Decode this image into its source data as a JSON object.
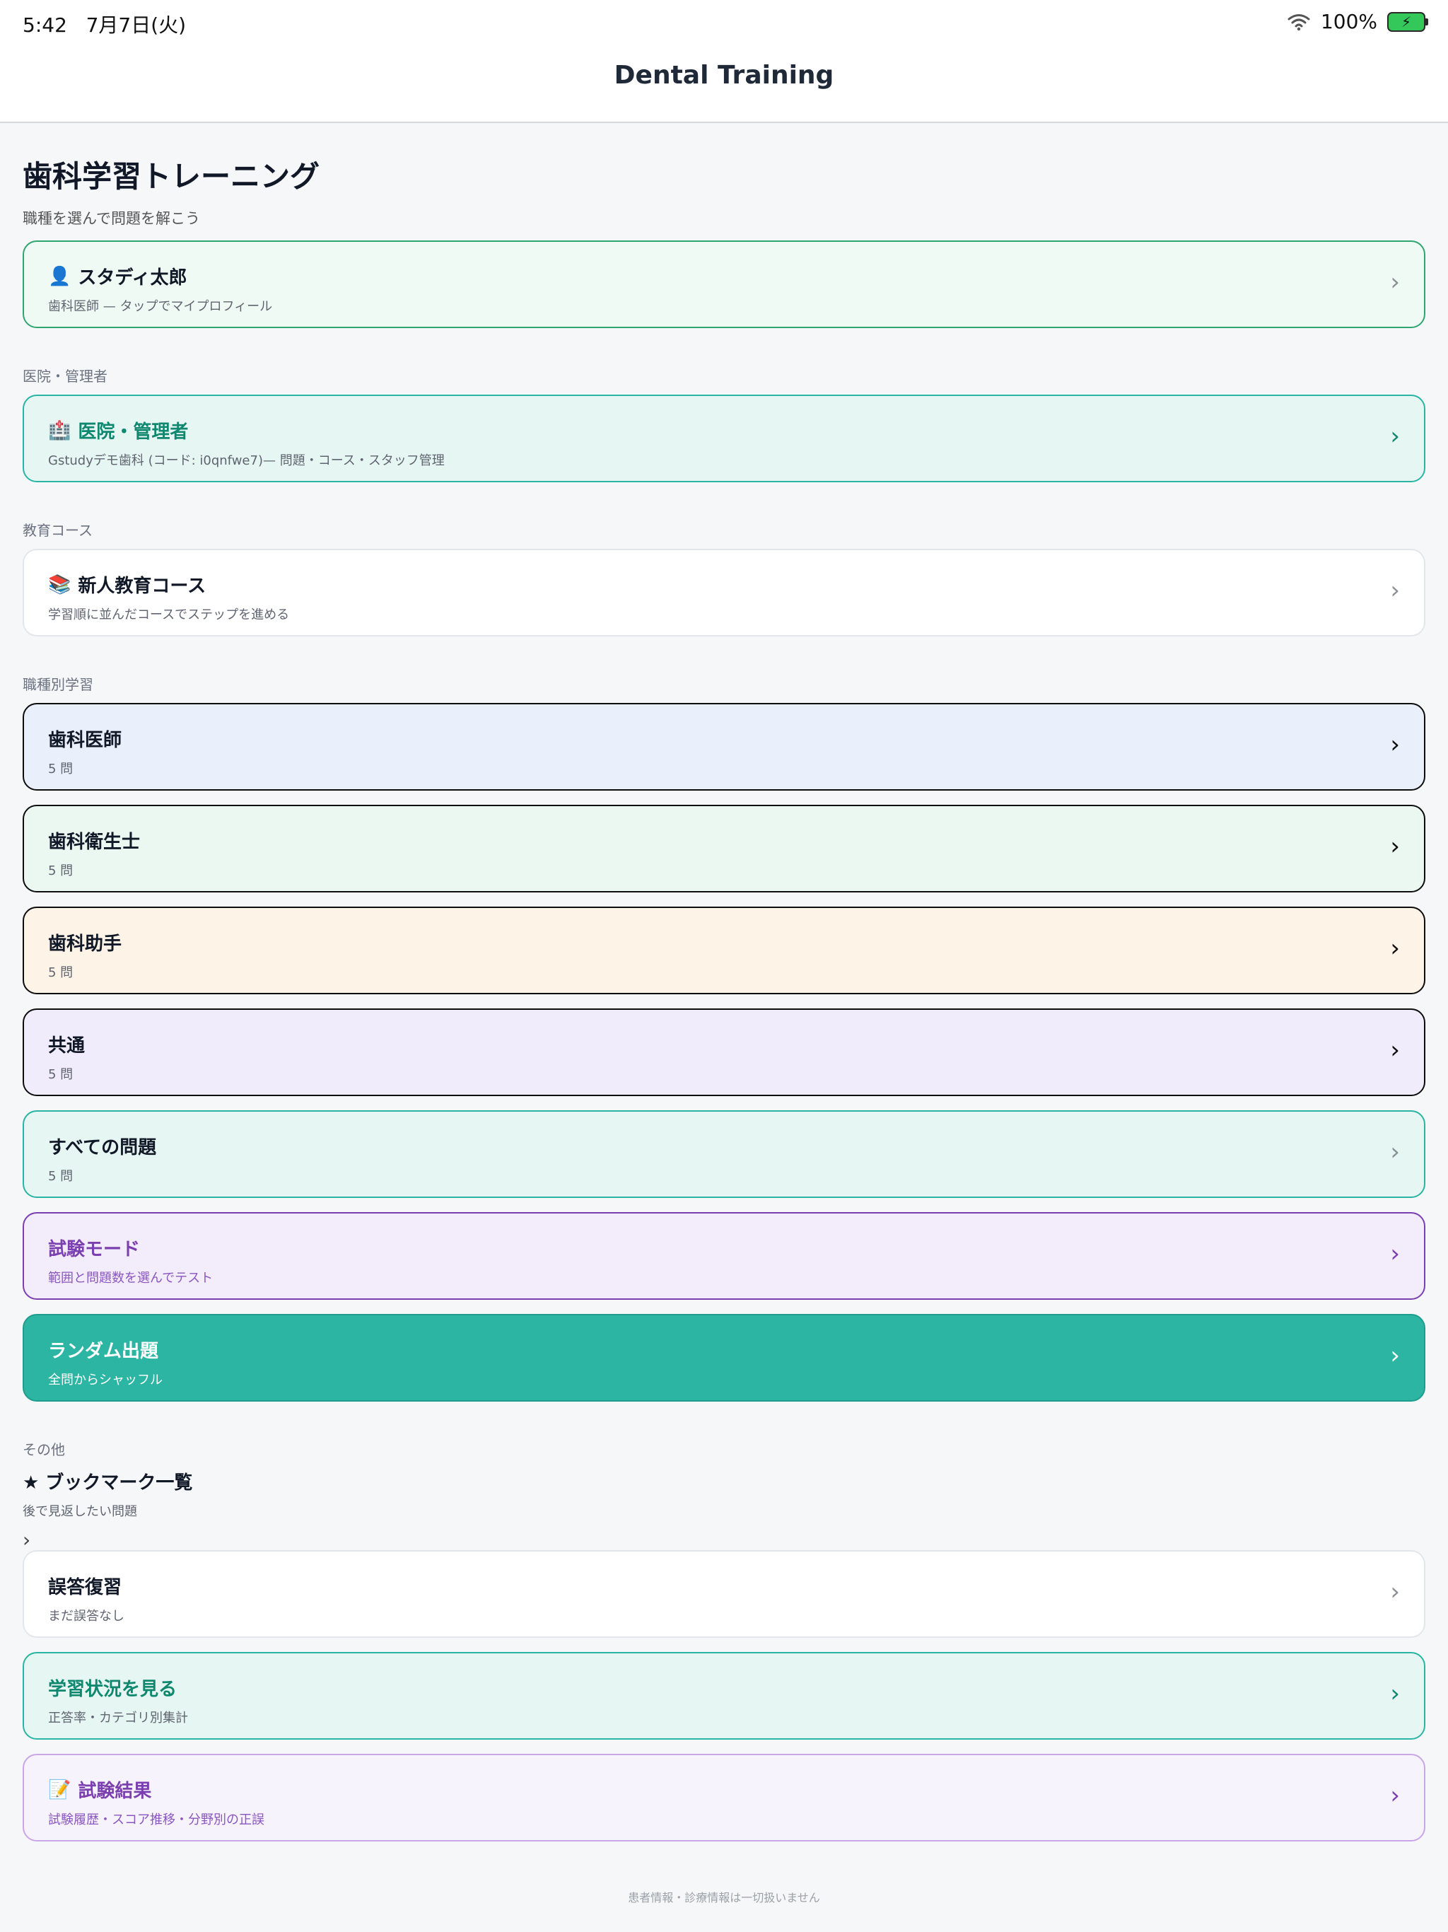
{
  "status_bar": {
    "time": "5:42",
    "date": "7月7日(火)",
    "battery": "100%"
  },
  "nav": {
    "title": "Dental Training"
  },
  "header": {
    "title": "歯科学習トレーニング",
    "subtitle": "職種を選んで問題を解こう"
  },
  "profile": {
    "icon": "👤",
    "name": "スタディ太郎",
    "detail": "歯科医師 — タップでマイプロフィール"
  },
  "sections": {
    "clinic": "医院・管理者",
    "course": "教育コース",
    "role": "職種別学習",
    "other": "その他"
  },
  "clinic_card": {
    "icon": "🏥",
    "title": "医院・管理者",
    "detail": "Gstudyデモ歯科 (コード: i0qnfwe7)— 問題・コース・スタッフ管理"
  },
  "course_card": {
    "icon": "📚",
    "title": "新人教育コース",
    "detail": "学習順に並んだコースでステップを進める"
  },
  "roles": [
    {
      "title": "歯科医師",
      "detail": "5 問"
    },
    {
      "title": "歯科衛生士",
      "detail": "5 問"
    },
    {
      "title": "歯科助手",
      "detail": "5 問"
    },
    {
      "title": "共通",
      "detail": "5 問"
    },
    {
      "title": "すべての問題",
      "detail": "5 問"
    }
  ],
  "exam_mode": {
    "title": "試験モード",
    "detail": "範囲と問題数を選んでテスト"
  },
  "random": {
    "title": "ランダム出題",
    "detail": "全問からシャッフル"
  },
  "bookmark": {
    "icon": "★",
    "title": "ブックマーク一覧",
    "detail": "後で見返したい問題"
  },
  "wrong_review": {
    "title": "誤答復習",
    "detail": "まだ誤答なし"
  },
  "progress": {
    "title": "学習状況を見る",
    "detail": "正答率・カテゴリ別集計"
  },
  "exam_results": {
    "icon": "📝",
    "title": "試験結果",
    "detail": "試験履歴・スコア推移・分野別の正誤"
  },
  "footer_text": "患者情報・診療情報は一切扱いません",
  "chevron": "›"
}
